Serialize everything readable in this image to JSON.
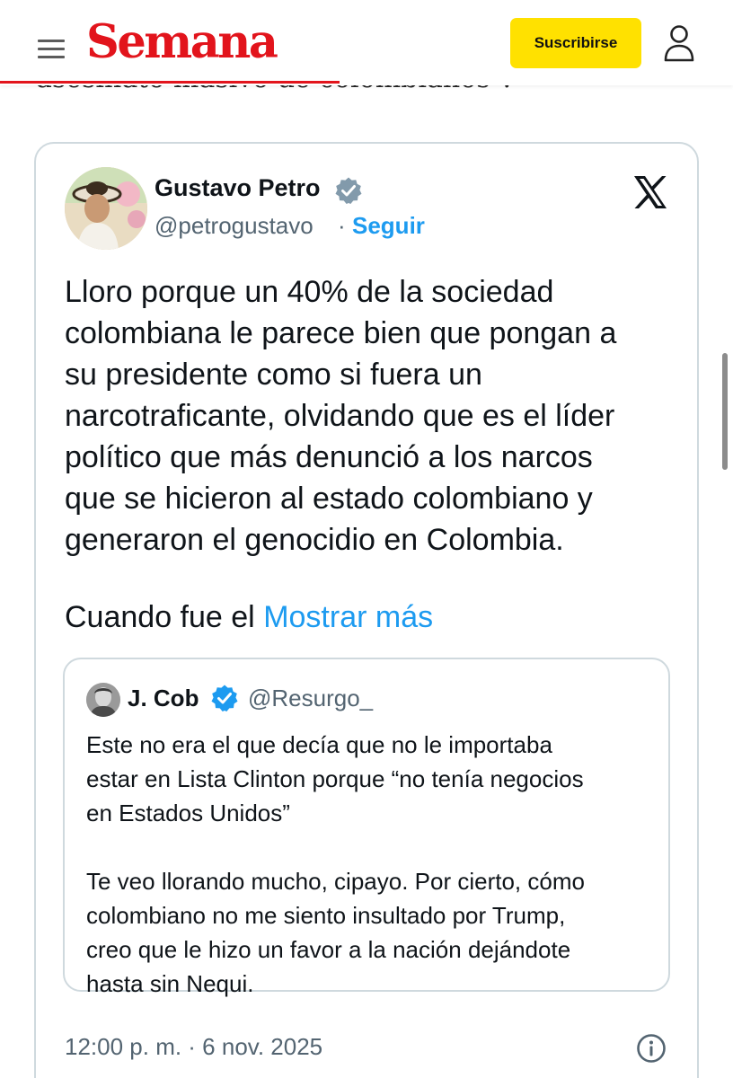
{
  "site": {
    "logo": "Semana",
    "subscribe_label": "Suscribirse",
    "accent_color": "#e2141c",
    "button_color": "#ffe100"
  },
  "article": {
    "partial_text": "asesinato masivo de colombianos\"."
  },
  "tweet": {
    "author_name": "Gustavo Petro",
    "handle": "@petrogustavo",
    "separator": "·",
    "follow_label": "Seguir",
    "body_lines": [
      "Lloro porque un 40% de la sociedad",
      "colombiana le parece bien que pongan a",
      "su presidente como si fuera un",
      "narcotraficante, olvidando que es el líder",
      "político que más denunció a los narcos",
      "que se hicieron al estado colombiano y",
      "generaron el genocidio en Colombia."
    ],
    "truncated_text": "Cuando fue el",
    "show_more_label": "Mostrar más",
    "timestamp": "12:00 p. m. · 6 nov. 2025",
    "link_color": "#1d9bf0",
    "icons": [
      "verified-badge-icon",
      "x-logo-icon",
      "info-icon"
    ]
  },
  "quoted_tweet": {
    "author_name": "J. Cob",
    "handle": "@Resurgo_",
    "paragraph_1": [
      "Este no era el que decía que no le importaba",
      "estar en Lista Clinton porque “no tenía negocios",
      "en Estados Unidos”"
    ],
    "paragraph_2": [
      "Te veo llorando mucho, cipayo. Por cierto, cómo",
      "colombiano no me siento insultado por Trump,",
      "creo que le hizo un favor a la nación dejándote",
      "hasta sin Nequi."
    ]
  }
}
